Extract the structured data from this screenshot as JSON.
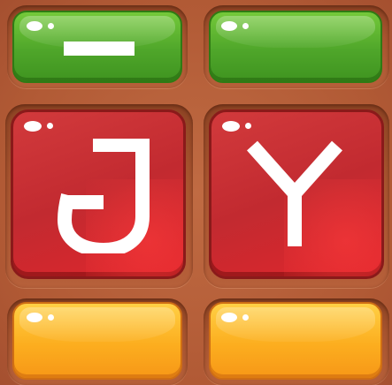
{
  "board": {
    "tiles": [
      {
        "color": "green",
        "symbol": "minus-bar-icon"
      },
      {
        "color": "green",
        "symbol": ""
      },
      {
        "color": "red",
        "symbol": "hooked-j-glyph-icon"
      },
      {
        "color": "red",
        "symbol": "y-glyph-icon"
      },
      {
        "color": "orange",
        "symbol": ""
      },
      {
        "color": "orange",
        "symbol": ""
      }
    ]
  },
  "colors": {
    "background": "#b5603a",
    "green": "#4fa62a",
    "red": "#c22a30",
    "orange": "#fcae1f",
    "glyph": "#ffffff"
  }
}
